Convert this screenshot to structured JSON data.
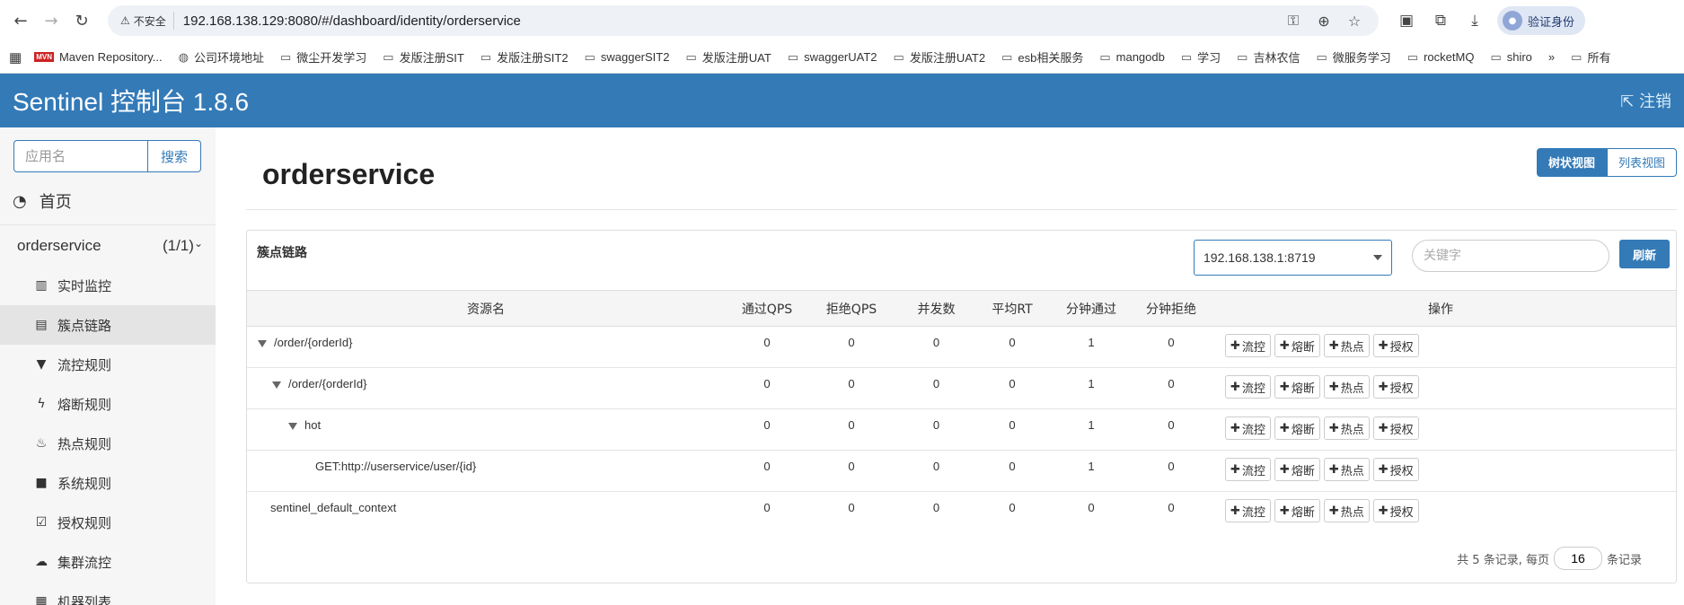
{
  "browser": {
    "security_label": "不安全",
    "url": "192.168.138.129:8080/#/dashboard/identity/orderservice",
    "verify_label": "验证身份",
    "bookmarks": [
      "Maven Repository...",
      "公司环境地址",
      "微尘开发学习",
      "发版注册SIT",
      "发版注册SIT2",
      "swaggerSIT2",
      "发版注册UAT",
      "swaggerUAT2",
      "发版注册UAT2",
      "esb相关服务",
      "mangodb",
      "学习",
      "吉林农信",
      "微服务学习",
      "rocketMQ",
      "shiro"
    ],
    "bookmarks_overflow": "»",
    "bookmarks_all": "所有"
  },
  "header": {
    "title": "Sentinel 控制台 1.8.6",
    "logout_label": "注销"
  },
  "sidebar": {
    "search_placeholder": "应用名",
    "search_button": "搜索",
    "home_label": "首页",
    "app_name": "orderservice",
    "app_count": "(1/1)",
    "menu": [
      {
        "label": "实时监控",
        "icon": "bar-chart-icon"
      },
      {
        "label": "簇点链路",
        "icon": "list-icon"
      },
      {
        "label": "流控规则",
        "icon": "filter-icon"
      },
      {
        "label": "熔断规则",
        "icon": "flash-icon"
      },
      {
        "label": "热点规则",
        "icon": "fire-icon"
      },
      {
        "label": "系统规则",
        "icon": "lock-icon"
      },
      {
        "label": "授权规则",
        "icon": "check-icon"
      },
      {
        "label": "集群流控",
        "icon": "cloud-icon"
      },
      {
        "label": "机器列表",
        "icon": "server-icon"
      }
    ]
  },
  "main": {
    "page_title": "orderservice",
    "view_tree": "树状视图",
    "view_list": "列表视图",
    "panel_title": "簇点链路",
    "machine": "192.168.138.1:8719",
    "keyword_placeholder": "关键字",
    "refresh_label": "刷新",
    "columns": [
      "资源名",
      "通过QPS",
      "拒绝QPS",
      "并发数",
      "平均RT",
      "分钟通过",
      "分钟拒绝",
      "操作"
    ],
    "rows": [
      {
        "name": "/order/{orderId}",
        "pass_qps": "0",
        "block_qps": "0",
        "concurrency": "0",
        "avg_rt": "0",
        "min_pass": "1",
        "min_block": "0"
      },
      {
        "name": "/order/{orderId}",
        "pass_qps": "0",
        "block_qps": "0",
        "concurrency": "0",
        "avg_rt": "0",
        "min_pass": "1",
        "min_block": "0"
      },
      {
        "name": "hot",
        "pass_qps": "0",
        "block_qps": "0",
        "concurrency": "0",
        "avg_rt": "0",
        "min_pass": "1",
        "min_block": "0"
      },
      {
        "name": "GET:http://userservice/user/{id}",
        "pass_qps": "0",
        "block_qps": "0",
        "concurrency": "0",
        "avg_rt": "0",
        "min_pass": "1",
        "min_block": "0"
      },
      {
        "name": "sentinel_default_context",
        "pass_qps": "0",
        "block_qps": "0",
        "concurrency": "0",
        "avg_rt": "0",
        "min_pass": "0",
        "min_block": "0"
      }
    ],
    "ops": [
      "流控",
      "熔断",
      "热点",
      "授权"
    ],
    "pager": {
      "prefix": "共 5 条记录, 每页",
      "page_size": "16",
      "suffix": "条记录"
    }
  },
  "colors": {
    "brand": "#337ab7"
  }
}
